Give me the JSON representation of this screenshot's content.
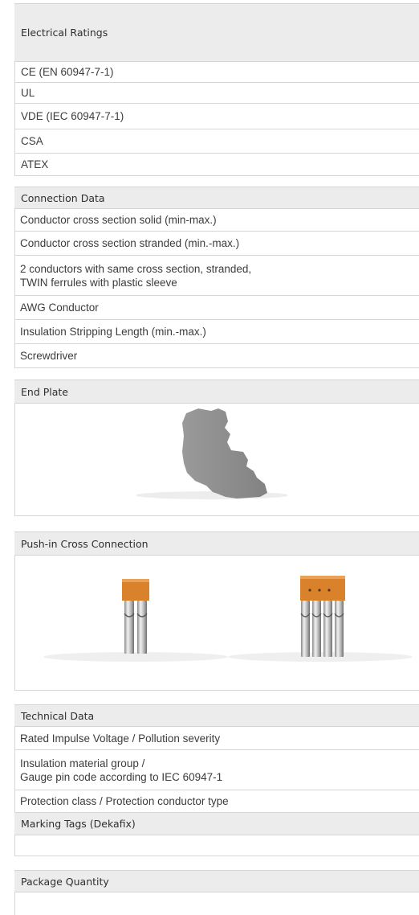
{
  "electrical_ratings": {
    "title": "Electrical Ratings",
    "items": [
      "CE (EN 60947-7-1)",
      "UL",
      "VDE (IEC 60947-7-1)",
      "CSA",
      "ATEX"
    ]
  },
  "connection_data": {
    "title": "Connection Data",
    "items": [
      "Conductor cross section solid (min-max.)",
      "Conductor cross section stranded (min.-max.)",
      "2 conductors with same cross section, stranded,",
      "TWIN ferrules with plastic sleeve",
      "AWG Conductor",
      "Insulation Stripping Length (min.-max.)",
      "Screwdriver"
    ]
  },
  "end_plate": {
    "title": "End Plate",
    "image": "end-plate-gray"
  },
  "push_in_cross_connection": {
    "title": "Push-in Cross Connection",
    "images": [
      "2-pole-bridge-orange",
      "4-pole-bridge-orange"
    ]
  },
  "technical_data": {
    "title": "Technical Data",
    "items": [
      "Rated Impulse Voltage / Pollution severity",
      "Insulation material group /",
      "Gauge pin code according to IEC 60947-1",
      "Protection class / Protection conductor type"
    ]
  },
  "marking_tags": {
    "title": "Marking Tags (Dekafix)"
  },
  "package_quantity": {
    "title": "Package Quantity"
  },
  "colors": {
    "header_bg": "#ececec",
    "border": "#d6d6d6",
    "orange": "#d9822b",
    "plate_gray": "#8c8c8c"
  }
}
